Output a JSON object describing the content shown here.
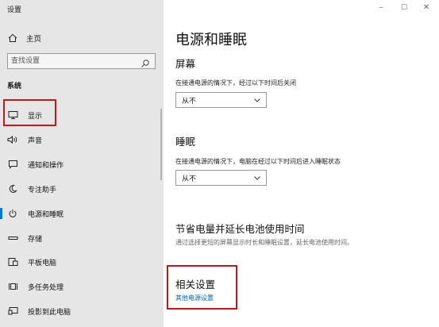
{
  "window": {
    "title": "设置",
    "controls": [
      "–",
      "☐",
      "✕"
    ]
  },
  "sidebar": {
    "home_label": "主页",
    "search_placeholder": "查找设置",
    "section_title": "系统",
    "items": [
      {
        "label": "显示",
        "icon": "monitor-icon"
      },
      {
        "label": "声音",
        "icon": "speaker-icon"
      },
      {
        "label": "通知和操作",
        "icon": "notification-icon"
      },
      {
        "label": "专注助手",
        "icon": "moon-icon"
      },
      {
        "label": "电源和睡眠",
        "icon": "power-icon",
        "active": true
      },
      {
        "label": "存储",
        "icon": "storage-icon"
      },
      {
        "label": "平板电脑",
        "icon": "tablet-icon"
      },
      {
        "label": "多任务处理",
        "icon": "multitask-icon"
      },
      {
        "label": "投影到此电脑",
        "icon": "project-icon"
      }
    ]
  },
  "main": {
    "title": "电源和睡眠",
    "screen": {
      "heading": "屏幕",
      "description": "在接通电源的情况下，经过以下时间后关闭",
      "value": "从不"
    },
    "sleep": {
      "heading": "睡眠",
      "description": "在接通电源的情况下，电脑在经过以下时间后进入睡眠状态",
      "value": "从不"
    },
    "battery": {
      "heading": "节省电量并延长电池使用时间",
      "description": "通过选择更短的屏幕显示时长和睡眠设置，延长电池使用时间。"
    },
    "related": {
      "heading": "相关设置",
      "link": "其他电源设置"
    }
  },
  "colors": {
    "accent": "#0078d7",
    "highlight_box": "#c4161c",
    "link": "#0063b1",
    "sidebar_bg": "#e6e6e6"
  }
}
